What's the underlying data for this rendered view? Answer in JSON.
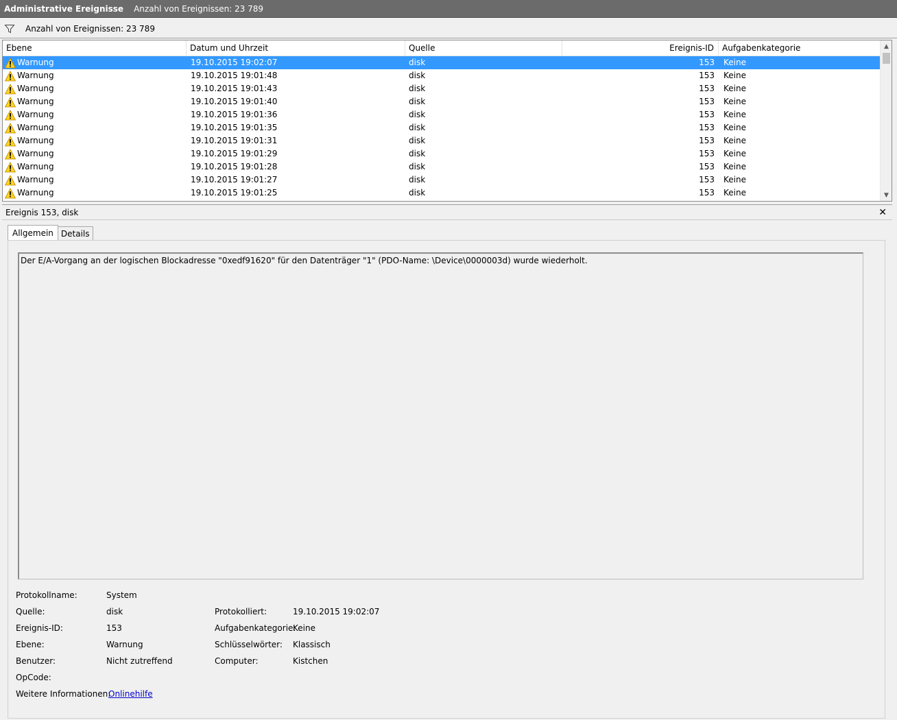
{
  "title_bar": {
    "title": "Administrative Ereignisse",
    "count_text": "Anzahl von Ereignissen: 23 789"
  },
  "filter_bar": {
    "icon": "filter-icon",
    "count_text": "Anzahl von Ereignissen: 23 789"
  },
  "columns": {
    "level": "Ebene",
    "datetime": "Datum und Uhrzeit",
    "source": "Quelle",
    "event_id": "Ereignis-ID",
    "category": "Aufgabenkategorie"
  },
  "rows": [
    {
      "level": "Warnung",
      "datetime": "19.10.2015 19:02:07",
      "source": "disk",
      "event_id": "153",
      "category": "Keine"
    },
    {
      "level": "Warnung",
      "datetime": "19.10.2015 19:01:48",
      "source": "disk",
      "event_id": "153",
      "category": "Keine"
    },
    {
      "level": "Warnung",
      "datetime": "19.10.2015 19:01:43",
      "source": "disk",
      "event_id": "153",
      "category": "Keine"
    },
    {
      "level": "Warnung",
      "datetime": "19.10.2015 19:01:40",
      "source": "disk",
      "event_id": "153",
      "category": "Keine"
    },
    {
      "level": "Warnung",
      "datetime": "19.10.2015 19:01:36",
      "source": "disk",
      "event_id": "153",
      "category": "Keine"
    },
    {
      "level": "Warnung",
      "datetime": "19.10.2015 19:01:35",
      "source": "disk",
      "event_id": "153",
      "category": "Keine"
    },
    {
      "level": "Warnung",
      "datetime": "19.10.2015 19:01:31",
      "source": "disk",
      "event_id": "153",
      "category": "Keine"
    },
    {
      "level": "Warnung",
      "datetime": "19.10.2015 19:01:29",
      "source": "disk",
      "event_id": "153",
      "category": "Keine"
    },
    {
      "level": "Warnung",
      "datetime": "19.10.2015 19:01:28",
      "source": "disk",
      "event_id": "153",
      "category": "Keine"
    },
    {
      "level": "Warnung",
      "datetime": "19.10.2015 19:01:27",
      "source": "disk",
      "event_id": "153",
      "category": "Keine"
    },
    {
      "level": "Warnung",
      "datetime": "19.10.2015 19:01:25",
      "source": "disk",
      "event_id": "153",
      "category": "Keine"
    }
  ],
  "selected_row_color": "#3399ff",
  "detail": {
    "header": "Ereignis 153, disk",
    "close_icon": "✕",
    "tabs": [
      "Allgemein",
      "Details"
    ],
    "message": "Der E/A-Vorgang an der logischen Blockadresse \"0xedf91620\" für den Datenträger \"1\" (PDO-Name: \\Device\\0000003d) wurde wiederholt.",
    "props": {
      "log_name_label": "Protokollname:",
      "log_name_value": "System",
      "source_label": "Quelle:",
      "source_value": "disk",
      "logged_label": "Protokolliert:",
      "logged_value": "19.10.2015 19:02:07",
      "event_id_label": "Ereignis-ID:",
      "event_id_value": "153",
      "task_cat_label": "Aufgabenkategorie:",
      "task_cat_value": "Keine",
      "level_label": "Ebene:",
      "level_value": "Warnung",
      "keywords_label": "Schlüsselwörter:",
      "keywords_value": "Klassisch",
      "user_label": "Benutzer:",
      "user_value": "Nicht zutreffend",
      "computer_label": "Computer:",
      "computer_value": "Kistchen",
      "opcode_label": "OpCode:",
      "more_info_label": "Weitere Informationen:",
      "more_info_link": "Onlinehilfe"
    }
  }
}
